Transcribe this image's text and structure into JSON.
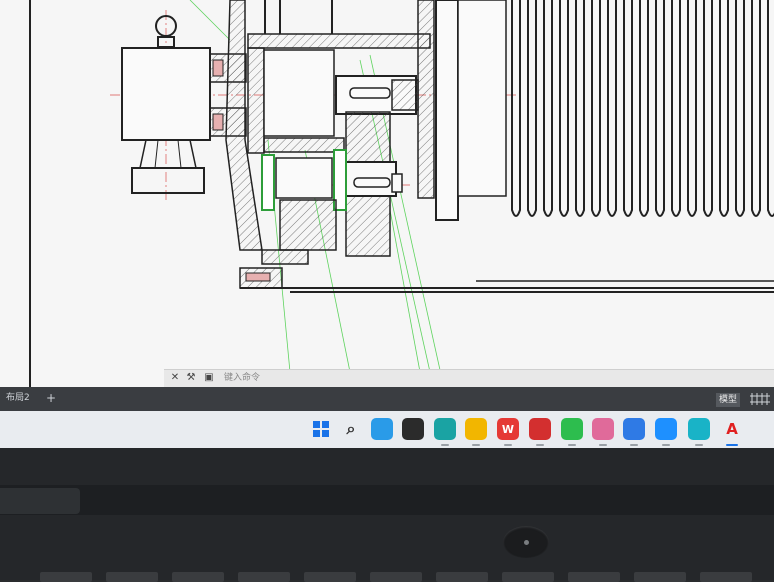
{
  "app": {
    "name": "AutoCAD drawing viewport"
  },
  "command_line": {
    "close_icon": "close-icon",
    "customize_icon": "wrench-icon",
    "prompt_placeholder": "键入命令"
  },
  "layout_bar": {
    "layout_tab": "布局2",
    "add_tab": "+",
    "model_label": "模型",
    "grid_icon": "grid-icon"
  },
  "taskbar": {
    "icons": [
      {
        "name": "windows-start-icon",
        "color": "#1a73e8"
      },
      {
        "name": "search-icon",
        "color": "#333333"
      },
      {
        "name": "copilot-icon",
        "color": "#2a9be8"
      },
      {
        "name": "app-y-icon",
        "color": "#2b2b2b"
      },
      {
        "name": "edge-browser-icon",
        "color": "#1aa3a3"
      },
      {
        "name": "file-explorer-icon",
        "color": "#f2b600"
      },
      {
        "name": "wps-office-icon",
        "color": "#e53935"
      },
      {
        "name": "app-red-icon",
        "color": "#d32f2f"
      },
      {
        "name": "wechat-icon",
        "color": "#2dbd4e"
      },
      {
        "name": "avatar-app-icon",
        "color": "#e06a9a"
      },
      {
        "name": "qq-icon",
        "color": "#2f7ae5"
      },
      {
        "name": "app-blue-icon",
        "color": "#1e90ff"
      },
      {
        "name": "app-teal-icon",
        "color": "#19b3c7"
      },
      {
        "name": "autocad-icon",
        "color": "#e02020"
      }
    ],
    "autocad_letter": "A",
    "wps_letter": "W"
  },
  "laptop": {
    "brand": ""
  }
}
